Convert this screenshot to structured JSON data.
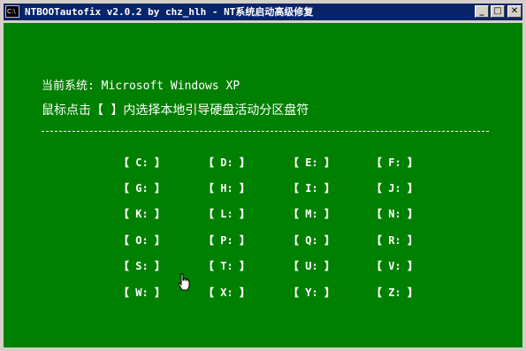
{
  "window": {
    "title": "NTBOOTautofix v2.0.2 by chz_hlh - NT系统启动高级修复",
    "icon_text": "C:\\",
    "buttons": {
      "minimize": "_",
      "maximize": "□",
      "close": "✕"
    }
  },
  "console": {
    "bg_color": "#008000",
    "system_line": "当前系统: Microsoft Windows XP",
    "instruction_line": "鼠标点击【 】内选择本地引导硬盘活动分区盘符",
    "drives": [
      "【 C: 】",
      "【 D: 】",
      "【 E: 】",
      "【 F: 】",
      "【 G: 】",
      "【 H: 】",
      "【 I: 】",
      "【 J: 】",
      "【 K: 】",
      "【 L: 】",
      "【 M: 】",
      "【 N: 】",
      "【 O: 】",
      "【 P: 】",
      "【 Q: 】",
      "【 R: 】",
      "【 S: 】",
      "【 T: 】",
      "【 U: 】",
      "【 V: 】",
      "【 W: 】",
      "【 X: 】",
      "【 Y: 】",
      "【 Z: 】"
    ]
  },
  "colors": {
    "titlebar": "#0a246a",
    "console_bg": "#008000",
    "text": "#ffffff"
  }
}
